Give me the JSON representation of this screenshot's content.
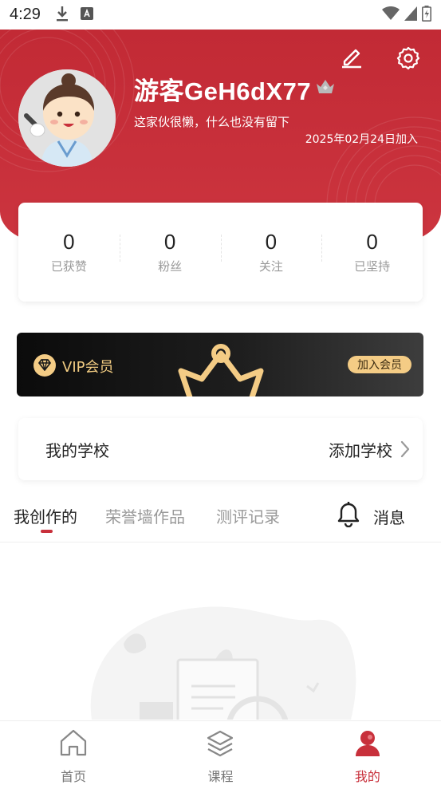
{
  "status_bar": {
    "time": "4:29"
  },
  "profile": {
    "username": "游客GeH6dX77",
    "bio": "这家伙很懒，什么也没有留下",
    "join_date": "2025年02月24日加入"
  },
  "stats": [
    {
      "value": "0",
      "label": "已获赞"
    },
    {
      "value": "0",
      "label": "粉丝"
    },
    {
      "value": "0",
      "label": "关注"
    },
    {
      "value": "0",
      "label": "已坚持"
    }
  ],
  "vip": {
    "label": "VIP会员",
    "join_label": "加入会员"
  },
  "school": {
    "title": "我的学校",
    "action": "添加学校"
  },
  "tabs": [
    {
      "label": "我创作的",
      "active": true
    },
    {
      "label": "荣誉墙作品",
      "active": false
    },
    {
      "label": "测评记录",
      "active": false
    }
  ],
  "messages": {
    "label": "消息"
  },
  "bottom_nav": [
    {
      "label": "首页",
      "icon": "home-icon",
      "active": false
    },
    {
      "label": "课程",
      "icon": "layers-icon",
      "active": false
    },
    {
      "label": "我的",
      "icon": "profile-icon",
      "active": true
    }
  ],
  "colors": {
    "brand_red": "#c8303b",
    "vip_gold": "#f4cc85"
  }
}
